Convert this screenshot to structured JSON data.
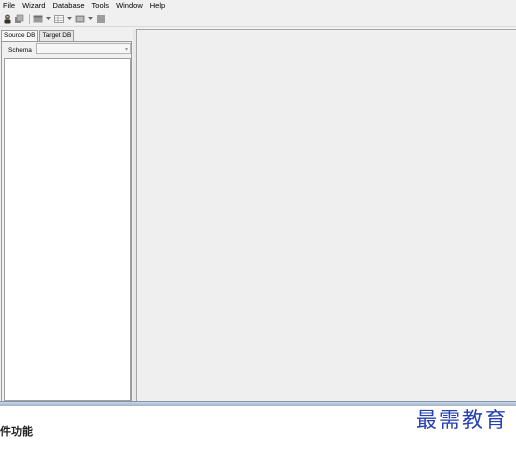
{
  "menu": {
    "items": [
      "File",
      "Wizard",
      "Database",
      "Tools",
      "Window",
      "Help"
    ]
  },
  "toolbar": {
    "icons": [
      "connect-icon",
      "disconnect-icon",
      "table-icon",
      "dropdown-icon",
      "grid-icon",
      "dropdown-icon",
      "view-icon",
      "dropdown-icon",
      "export-icon"
    ]
  },
  "left_panel": {
    "tabs": [
      "Source DB",
      "Target DB"
    ],
    "active_tab": "Source DB",
    "schema_label": "Schema",
    "schema_value": ""
  },
  "caption": "件功能",
  "watermark": "最需教育",
  "colors": {
    "watermark": "#2540b0",
    "panel_bg": "#f0f0f0",
    "tree_bg": "#ffffff"
  }
}
